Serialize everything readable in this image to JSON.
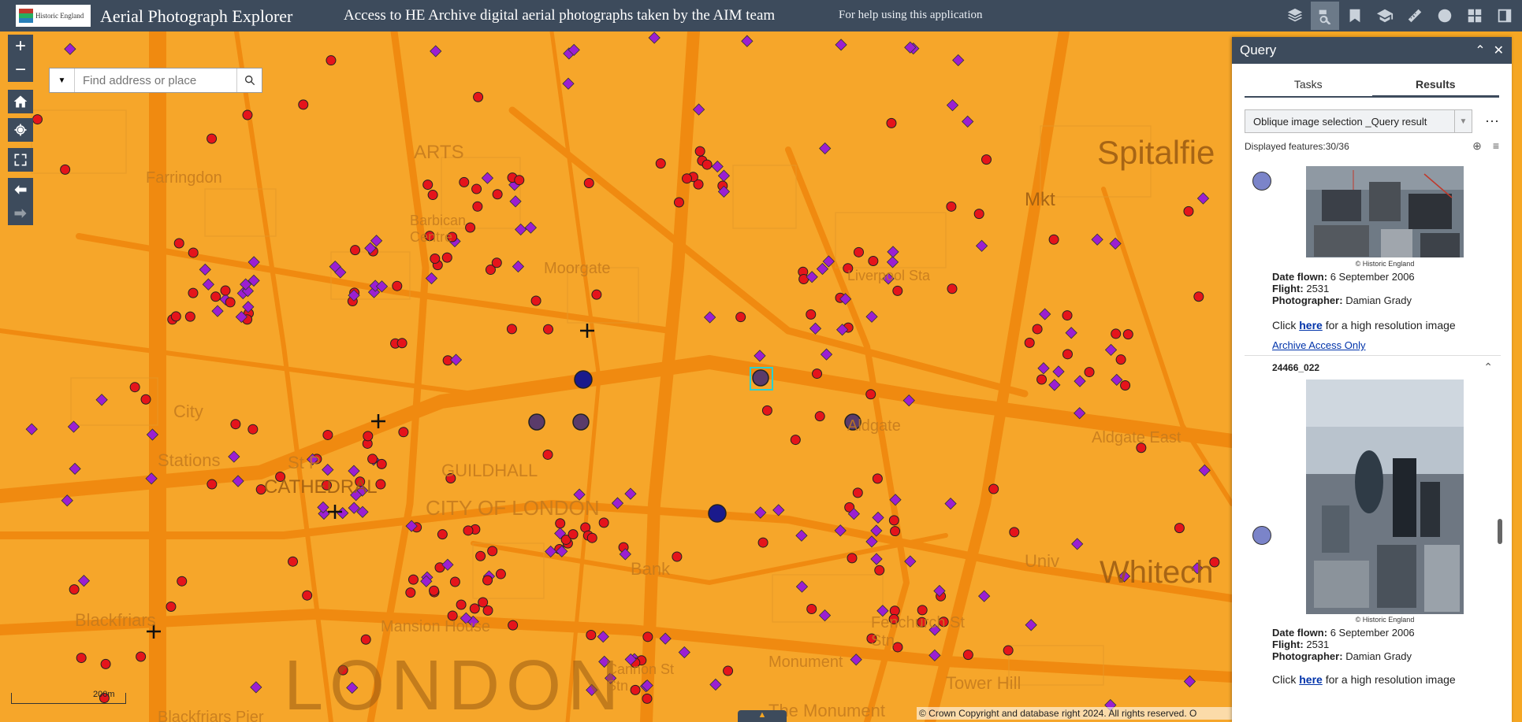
{
  "header": {
    "logo_text": "Historic England",
    "app_title": "Aerial Photograph Explorer",
    "subtitle": "Access to HE Archive digital aerial photographs taken by the AIM team",
    "help_link": "For help using this application",
    "tools": [
      "layers-icon",
      "query-icon",
      "bookmark-icon",
      "graduation-cap-icon",
      "measure-icon",
      "filter-icon",
      "widgets-icon",
      "panel-toggle-icon"
    ]
  },
  "map": {
    "search_placeholder": "Find address or place",
    "scale_label": "200m",
    "copyright": "© Crown Copyright and database right 2024. All rights reserved. O",
    "labels": [
      "Farringdon",
      "Moorgate",
      "Spitalfie",
      "Mkt",
      "City",
      "Stations",
      "St P",
      "CATHEDRAL",
      "Aldgate",
      "Aldgate East",
      "Blackfriars",
      "Mansion House",
      "LONDON",
      "Bank",
      "Monument",
      "Fenchurch St Stn",
      "Tower Hill",
      "Whitech",
      "Univ",
      "ARTS",
      "Barbican Centre",
      "Liverpool Sta",
      "GUILDHALL",
      "CITY OF LONDON",
      "Blackfriars Pier",
      "The Monument",
      "Cannon St Stn"
    ]
  },
  "panel": {
    "title": "Query",
    "tabs": [
      "Tasks",
      "Results"
    ],
    "active_tab": "Results",
    "result_select": "Oblique image selection _Query result",
    "displayed": "Displayed features:30/36",
    "results": [
      {
        "credit": "© Historic England",
        "date_label": "Date flown:",
        "date": "6 September 2006",
        "flight_label": "Flight:",
        "flight": "2531",
        "photographer_label": "Photographer:",
        "photographer": "Damian Grady",
        "click_pre": "Click",
        "click_link": "here",
        "click_post": "for a high resolution image",
        "access": "Archive Access Only"
      },
      {
        "id": "24466_022",
        "credit": "© Historic England",
        "date_label": "Date flown:",
        "date": "6 September 2006",
        "flight_label": "Flight:",
        "flight": "2531",
        "photographer_label": "Photographer:",
        "photographer": "Damian Grady",
        "click_pre": "Click",
        "click_link": "here",
        "click_post": "for a high resolution image"
      }
    ]
  },
  "colors": {
    "header_bg": "#3d4b5c",
    "map_bg": "#f6a62a",
    "red_point": "#e5141b",
    "purple_point": "#9b1fd1",
    "selected_point": "#1a1a8c"
  }
}
